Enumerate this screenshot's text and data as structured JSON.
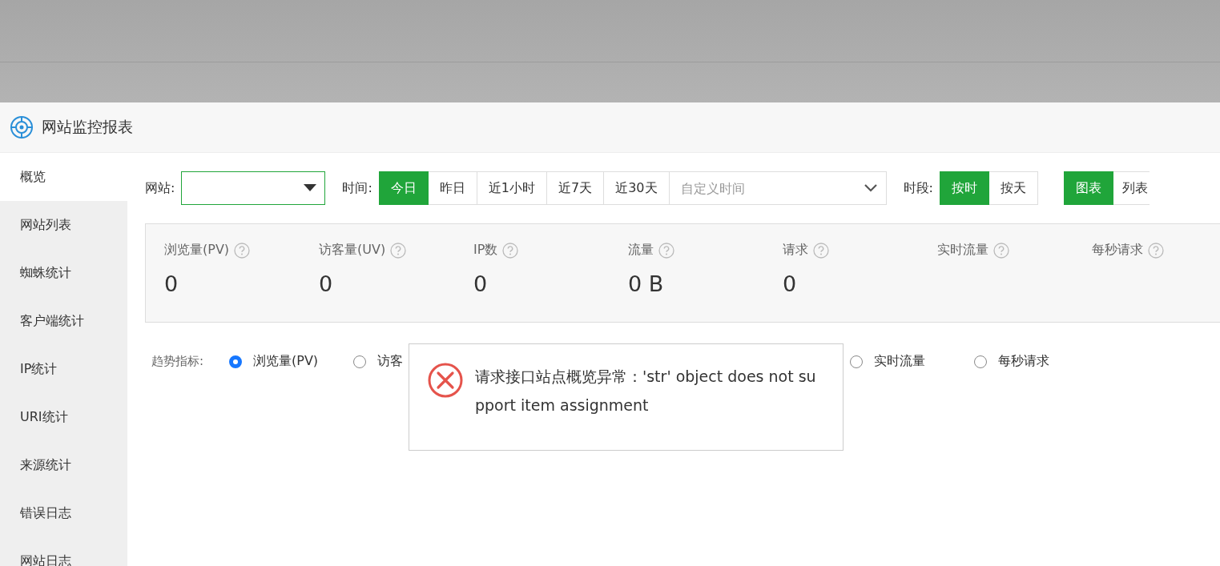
{
  "window": {
    "title": "网站监控报表"
  },
  "sidebar": {
    "items": [
      {
        "label": "概览",
        "selected": true
      },
      {
        "label": "网站列表",
        "selected": false
      },
      {
        "label": "蜘蛛统计",
        "selected": false
      },
      {
        "label": "客户端统计",
        "selected": false
      },
      {
        "label": "IP统计",
        "selected": false
      },
      {
        "label": "URI统计",
        "selected": false
      },
      {
        "label": "来源统计",
        "selected": false
      },
      {
        "label": "错误日志",
        "selected": false
      },
      {
        "label": "网站日志",
        "selected": false
      }
    ]
  },
  "filters": {
    "site_label": "网站:",
    "time_label": "时间:",
    "time_buttons": [
      {
        "label": "今日",
        "selected": true
      },
      {
        "label": "昨日",
        "selected": false
      },
      {
        "label": "近1小时",
        "selected": false
      },
      {
        "label": "近7天",
        "selected": false
      },
      {
        "label": "近30天",
        "selected": false
      }
    ],
    "custom_time": {
      "placeholder": "自定义时间"
    },
    "period_label": "时段:",
    "period_buttons": [
      {
        "label": "按时",
        "selected": true
      },
      {
        "label": "按天",
        "selected": false
      }
    ],
    "view_buttons": [
      {
        "label": "图表",
        "selected": true
      },
      {
        "label": "列表",
        "selected": false
      }
    ]
  },
  "stats": [
    {
      "label": "浏览量(PV)",
      "value": "0"
    },
    {
      "label": "访客量(UV)",
      "value": "0"
    },
    {
      "label": "IP数",
      "value": "0"
    },
    {
      "label": "流量",
      "value": "0 B"
    },
    {
      "label": "请求",
      "value": "0"
    },
    {
      "label": "实时流量"
    },
    {
      "label": "每秒请求"
    }
  ],
  "trend": {
    "label": "趋势指标:",
    "options": [
      {
        "label": "浏览量(PV)",
        "selected": true
      },
      {
        "label": "访客",
        "selected": false
      },
      {
        "label": "实时流量",
        "selected": false
      },
      {
        "label": "每秒请求",
        "selected": false
      }
    ]
  },
  "dialog": {
    "message": "请求接口站点概览异常：'str' object does not support item assignment"
  }
}
